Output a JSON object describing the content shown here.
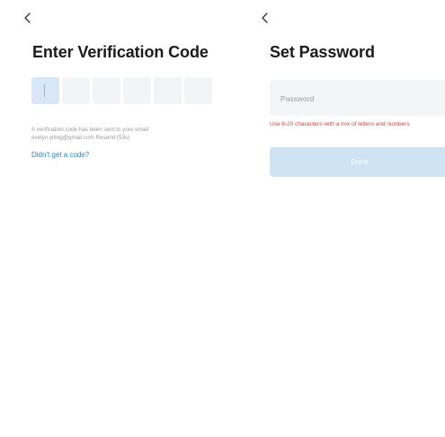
{
  "left_screen": {
    "back_icon": "chevron-left-icon",
    "title": "Enter Verification Code",
    "code_boxes": 6,
    "info_line1": "A verification code has been sent to your email",
    "info_email": "evelyn.yiting@gmail.com",
    "info_resend": "Resend (53s)",
    "link": "Didn't get a code?"
  },
  "right_screen": {
    "back_icon": "chevron-left-icon",
    "title": "Set Password",
    "password_placeholder": "Password",
    "password_value": "",
    "hint": "Use 6-20 characters with a mix of letters and numbers",
    "done_label": "Done"
  },
  "colors": {
    "accent_link": "#2a86c8",
    "active_box": "#d7e7f8",
    "error_text": "#d94141",
    "disabled_button": "#cfe3f3"
  }
}
